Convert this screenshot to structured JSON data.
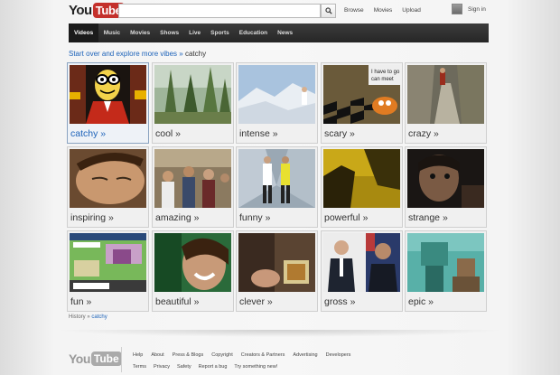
{
  "header": {
    "logo_you": "You",
    "logo_tube": "Tube",
    "search_placeholder": "",
    "links": [
      "Browse",
      "Movies",
      "Upload"
    ],
    "signin": "Sign in"
  },
  "nav": {
    "tabs": [
      "Videos",
      "Music",
      "Movies",
      "Shows",
      "Live",
      "Sports",
      "Education",
      "News"
    ],
    "active": "Videos"
  },
  "breadcrumb": {
    "link": "Start over and explore more vibes",
    "separator": "»",
    "current": "catchy"
  },
  "tiles": [
    {
      "label": "catchy »",
      "icon": "cartoon-character"
    },
    {
      "label": "cool »",
      "icon": "forest-trees"
    },
    {
      "label": "intense »",
      "icon": "snowy-mountain"
    },
    {
      "label": "scary »",
      "icon": "cartoon-checkerboard"
    },
    {
      "label": "crazy »",
      "icon": "rocky-stairs"
    },
    {
      "label": "inspiring »",
      "icon": "face-closeup"
    },
    {
      "label": "amazing »",
      "icon": "crowd"
    },
    {
      "label": "funny »",
      "icon": "two-people-stage"
    },
    {
      "label": "powerful »",
      "icon": "shadow-figure"
    },
    {
      "label": "strange »",
      "icon": "dark-face"
    },
    {
      "label": "fun »",
      "icon": "pixel-game"
    },
    {
      "label": "beautiful »",
      "icon": "smiling-woman"
    },
    {
      "label": "clever »",
      "icon": "hands-card"
    },
    {
      "label": "gross »",
      "icon": "two-politicians"
    },
    {
      "label": "epic »",
      "icon": "blocky-figure"
    }
  ],
  "history": {
    "label": "History",
    "separator": "»",
    "current": "catchy"
  },
  "footer": {
    "logo_you": "You",
    "logo_tube": "Tube",
    "row1": [
      "Help",
      "About",
      "Press & Blogs",
      "Copyright",
      "Creators & Partners",
      "Advertising",
      "Developers"
    ],
    "row2": [
      "Terms",
      "Privacy",
      "Safety",
      "Report a bug",
      "Try something new!"
    ]
  },
  "colors": {
    "accent": "#c4302b",
    "link": "#1c62b9",
    "nav_bg": "#2c2c2c"
  }
}
